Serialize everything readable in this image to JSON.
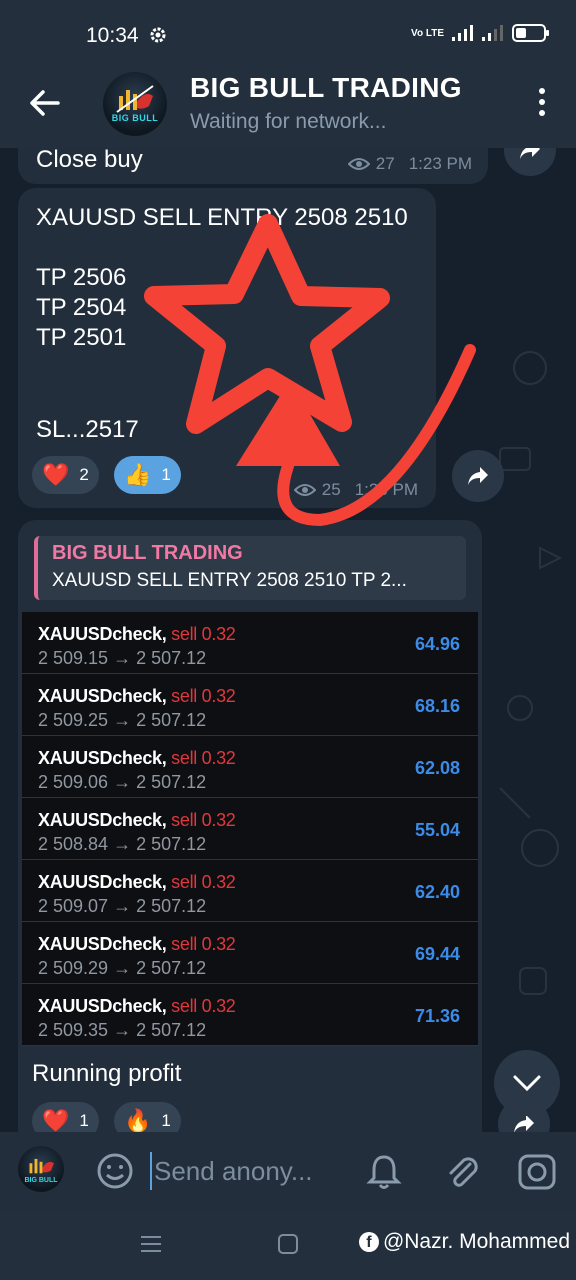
{
  "status_bar": {
    "time": "10:34",
    "network": "Vo LTE"
  },
  "header": {
    "title": "BIG BULL TRADING",
    "subtitle": "Waiting for network...",
    "avatar_text": "BIG BULL"
  },
  "messages": {
    "m1": {
      "text": "Close buy",
      "views": "27",
      "time": "1:23 PM"
    },
    "m2": {
      "lines": [
        "XAUUSD SELL ENTRY 2508 2510",
        "TP 2506",
        "TP 2504",
        "TP 2501",
        "SL...2517"
      ],
      "reactions": [
        {
          "emoji": "❤️",
          "count": "2"
        },
        {
          "emoji": "👍",
          "count": "1"
        }
      ],
      "views": "25",
      "time": "1:26 PM"
    },
    "m3": {
      "reply": {
        "title": "BIG BULL TRADING",
        "text": "XAUUSD SELL ENTRY 2508 2510  TP 2..."
      },
      "trades": [
        {
          "symbol": "XAUUSDcheck,",
          "side": "sell 0.32",
          "prices": "2 509.15 → 2 507.12",
          "profit": "64.96"
        },
        {
          "symbol": "XAUUSDcheck,",
          "side": "sell 0.32",
          "prices": "2 509.25 → 2 507.12",
          "profit": "68.16"
        },
        {
          "symbol": "XAUUSDcheck,",
          "side": "sell 0.32",
          "prices": "2 509.06 → 2 507.12",
          "profit": "62.08"
        },
        {
          "symbol": "XAUUSDcheck,",
          "side": "sell 0.32",
          "prices": "2 508.84 → 2 507.12",
          "profit": "55.04"
        },
        {
          "symbol": "XAUUSDcheck,",
          "side": "sell 0.32",
          "prices": "2 509.07 → 2 507.12",
          "profit": "62.40"
        },
        {
          "symbol": "XAUUSDcheck,",
          "side": "sell 0.32",
          "prices": "2 509.29 → 2 507.12",
          "profit": "69.44"
        },
        {
          "symbol": "XAUUSDcheck,",
          "side": "sell 0.32",
          "prices": "2 509.35 → 2 507.12",
          "profit": "71.36"
        }
      ],
      "caption": "Running profit",
      "reactions": [
        {
          "emoji": "❤️",
          "count": "1"
        },
        {
          "emoji": "🔥",
          "count": "1"
        }
      ]
    }
  },
  "input": {
    "placeholder": "Send anony..."
  },
  "credit": {
    "text": "@Nazr. Mohammed",
    "icon": "facebook-icon"
  },
  "colors": {
    "accent": "#5aa3e0",
    "quote_title": "#f07aa4",
    "sell": "#e0383c",
    "profit": "#3d8be8",
    "annotation": "#f44336"
  }
}
